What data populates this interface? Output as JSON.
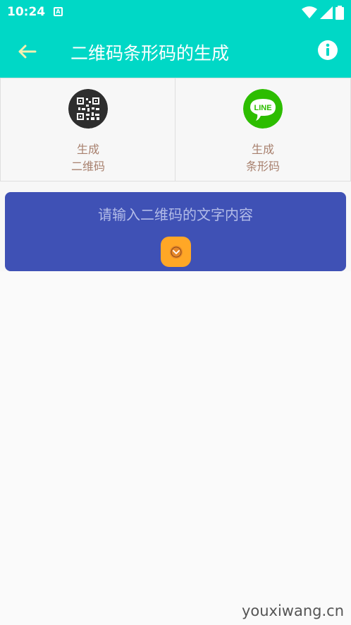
{
  "status_bar": {
    "time": "10:24",
    "notification_letter": "A"
  },
  "app_bar": {
    "title": "二维码条形码的生成"
  },
  "tiles": [
    {
      "line1": "生成",
      "line2": "二维码"
    },
    {
      "line1": "生成",
      "line2": "条形码",
      "icon_text": "LINE"
    }
  ],
  "input_card": {
    "placeholder": "请输入二维码的文字内容"
  },
  "watermark": "youxiwang.cn",
  "colors": {
    "primary": "#00d8c6",
    "card": "#3f51b5",
    "accent": "#ffa726",
    "label": "#a8806e"
  }
}
